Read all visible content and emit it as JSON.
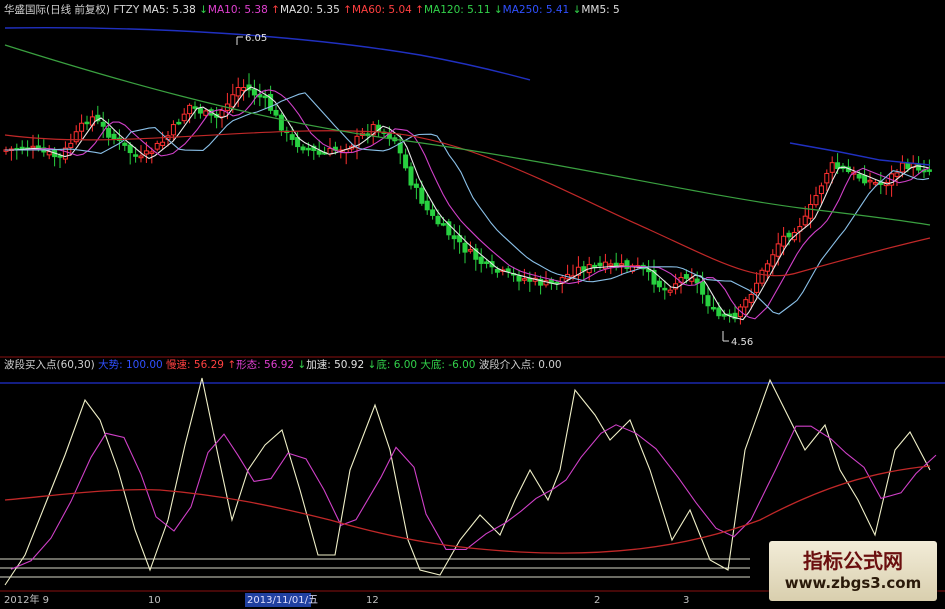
{
  "main_panel": {
    "header": [
      {
        "text": "华盛国际(日线 前复权) FTZY",
        "color": "#d0d0d0"
      },
      {
        "text": "MA5: 5.38",
        "color": "#e0e0e0"
      },
      {
        "text": "↓",
        "color": "#32d14a"
      },
      {
        "text": "MA10: 5.38",
        "color": "#e040d0"
      },
      {
        "text": "↑",
        "color": "#ff4040"
      },
      {
        "text": "MA20: 5.35",
        "color": "#e0e0e0"
      },
      {
        "text": "↑",
        "color": "#ff4040"
      },
      {
        "text": "MA60: 5.04",
        "color": "#ff4040"
      },
      {
        "text": "↑",
        "color": "#ff4040"
      },
      {
        "text": "MA120: 5.11",
        "color": "#32d14a"
      },
      {
        "text": "↓",
        "color": "#32d14a"
      },
      {
        "text": "MA250: 5.41",
        "color": "#3050ff"
      },
      {
        "text": "↓",
        "color": "#32d14a"
      },
      {
        "text": "MM5: 5",
        "color": "#e0e0e0"
      }
    ],
    "high_label": "6.05",
    "low_label": "4.56"
  },
  "indicator_panel": {
    "header": [
      {
        "text": "波段买入点(60,30)",
        "color": "#d0d0d0"
      },
      {
        "text": "大势: 100.00",
        "color": "#3050ff"
      },
      {
        "text": "慢速: 56.29",
        "color": "#ff4040"
      },
      {
        "text": "↑",
        "color": "#ff4040"
      },
      {
        "text": "形态: 56.92",
        "color": "#e040d0"
      },
      {
        "text": "↓",
        "color": "#32d14a"
      },
      {
        "text": "加速: 50.92",
        "color": "#e0e0e0"
      },
      {
        "text": "↓",
        "color": "#32d14a"
      },
      {
        "text": "底: 6.00",
        "color": "#32d14a"
      },
      {
        "text": "大底: -6.00",
        "color": "#32d14a"
      },
      {
        "text": "波段介入点: 0.00",
        "color": "#d0d0d0"
      }
    ]
  },
  "x_axis": [
    "2012年 9",
    "10",
    "2013/11/01/五",
    "12",
    "2",
    "3"
  ],
  "watermark": {
    "title": "指标公式网",
    "url": "www.zbgs3.com"
  },
  "colors": {
    "up": "#ff3030",
    "down": "#28d040",
    "ma5": "#e8e8e8",
    "ma10": "#d040c8",
    "ma20": "#8ac0e8",
    "ma60": "#c02828",
    "ma120": "#3aa040",
    "ma250": "#2030c0",
    "slow": "#c02828",
    "shape": "#d040c8",
    "accel": "#f0f0c8"
  }
}
